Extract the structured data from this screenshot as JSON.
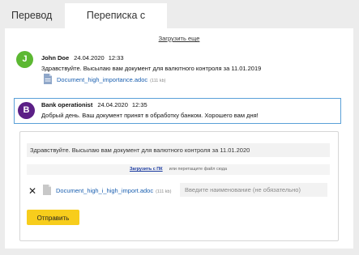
{
  "tabs": [
    {
      "label": "Перевод",
      "active": false
    },
    {
      "label": "Переписка с банком",
      "active": true
    }
  ],
  "load_more": "Загрузить еще",
  "messages": [
    {
      "avatar_letter": "J",
      "avatar_color": "#5cb832",
      "author": "John Doe",
      "date": "24.04.2020",
      "time": "12:33",
      "text": "Здравствуйте. Высылаю вам документ для валютного контроля за 11.01.2019",
      "file": {
        "name": "Document_high_importance.adoc",
        "size": "(111 kb)"
      }
    },
    {
      "avatar_letter": "B",
      "avatar_color": "#5b1f86",
      "author": "Bank operationist",
      "date": "24.04.2020",
      "time": "12:35",
      "text": "Добрый день. Ваш документ принят в обработку банком. Хорошего вам дня!"
    }
  ],
  "compose": {
    "text": "Здравствуйте. Высылаю вам документ для валютного контроля за 11.01.2020",
    "upload_link": "Загрузить с ПК",
    "upload_hint": "или перетащите файл сюда",
    "remove_glyph": "✕",
    "file": {
      "name": "Document_high_i_high_import.adoc",
      "size": "(111 kb)"
    },
    "name_placeholder": "Введите наименование (не обязательно)",
    "send_label": "Отправить"
  },
  "colors": {
    "accent_yellow": "#f7cd1c",
    "link_blue": "#1a5fb0",
    "highlight_border": "#5aa0d8"
  }
}
